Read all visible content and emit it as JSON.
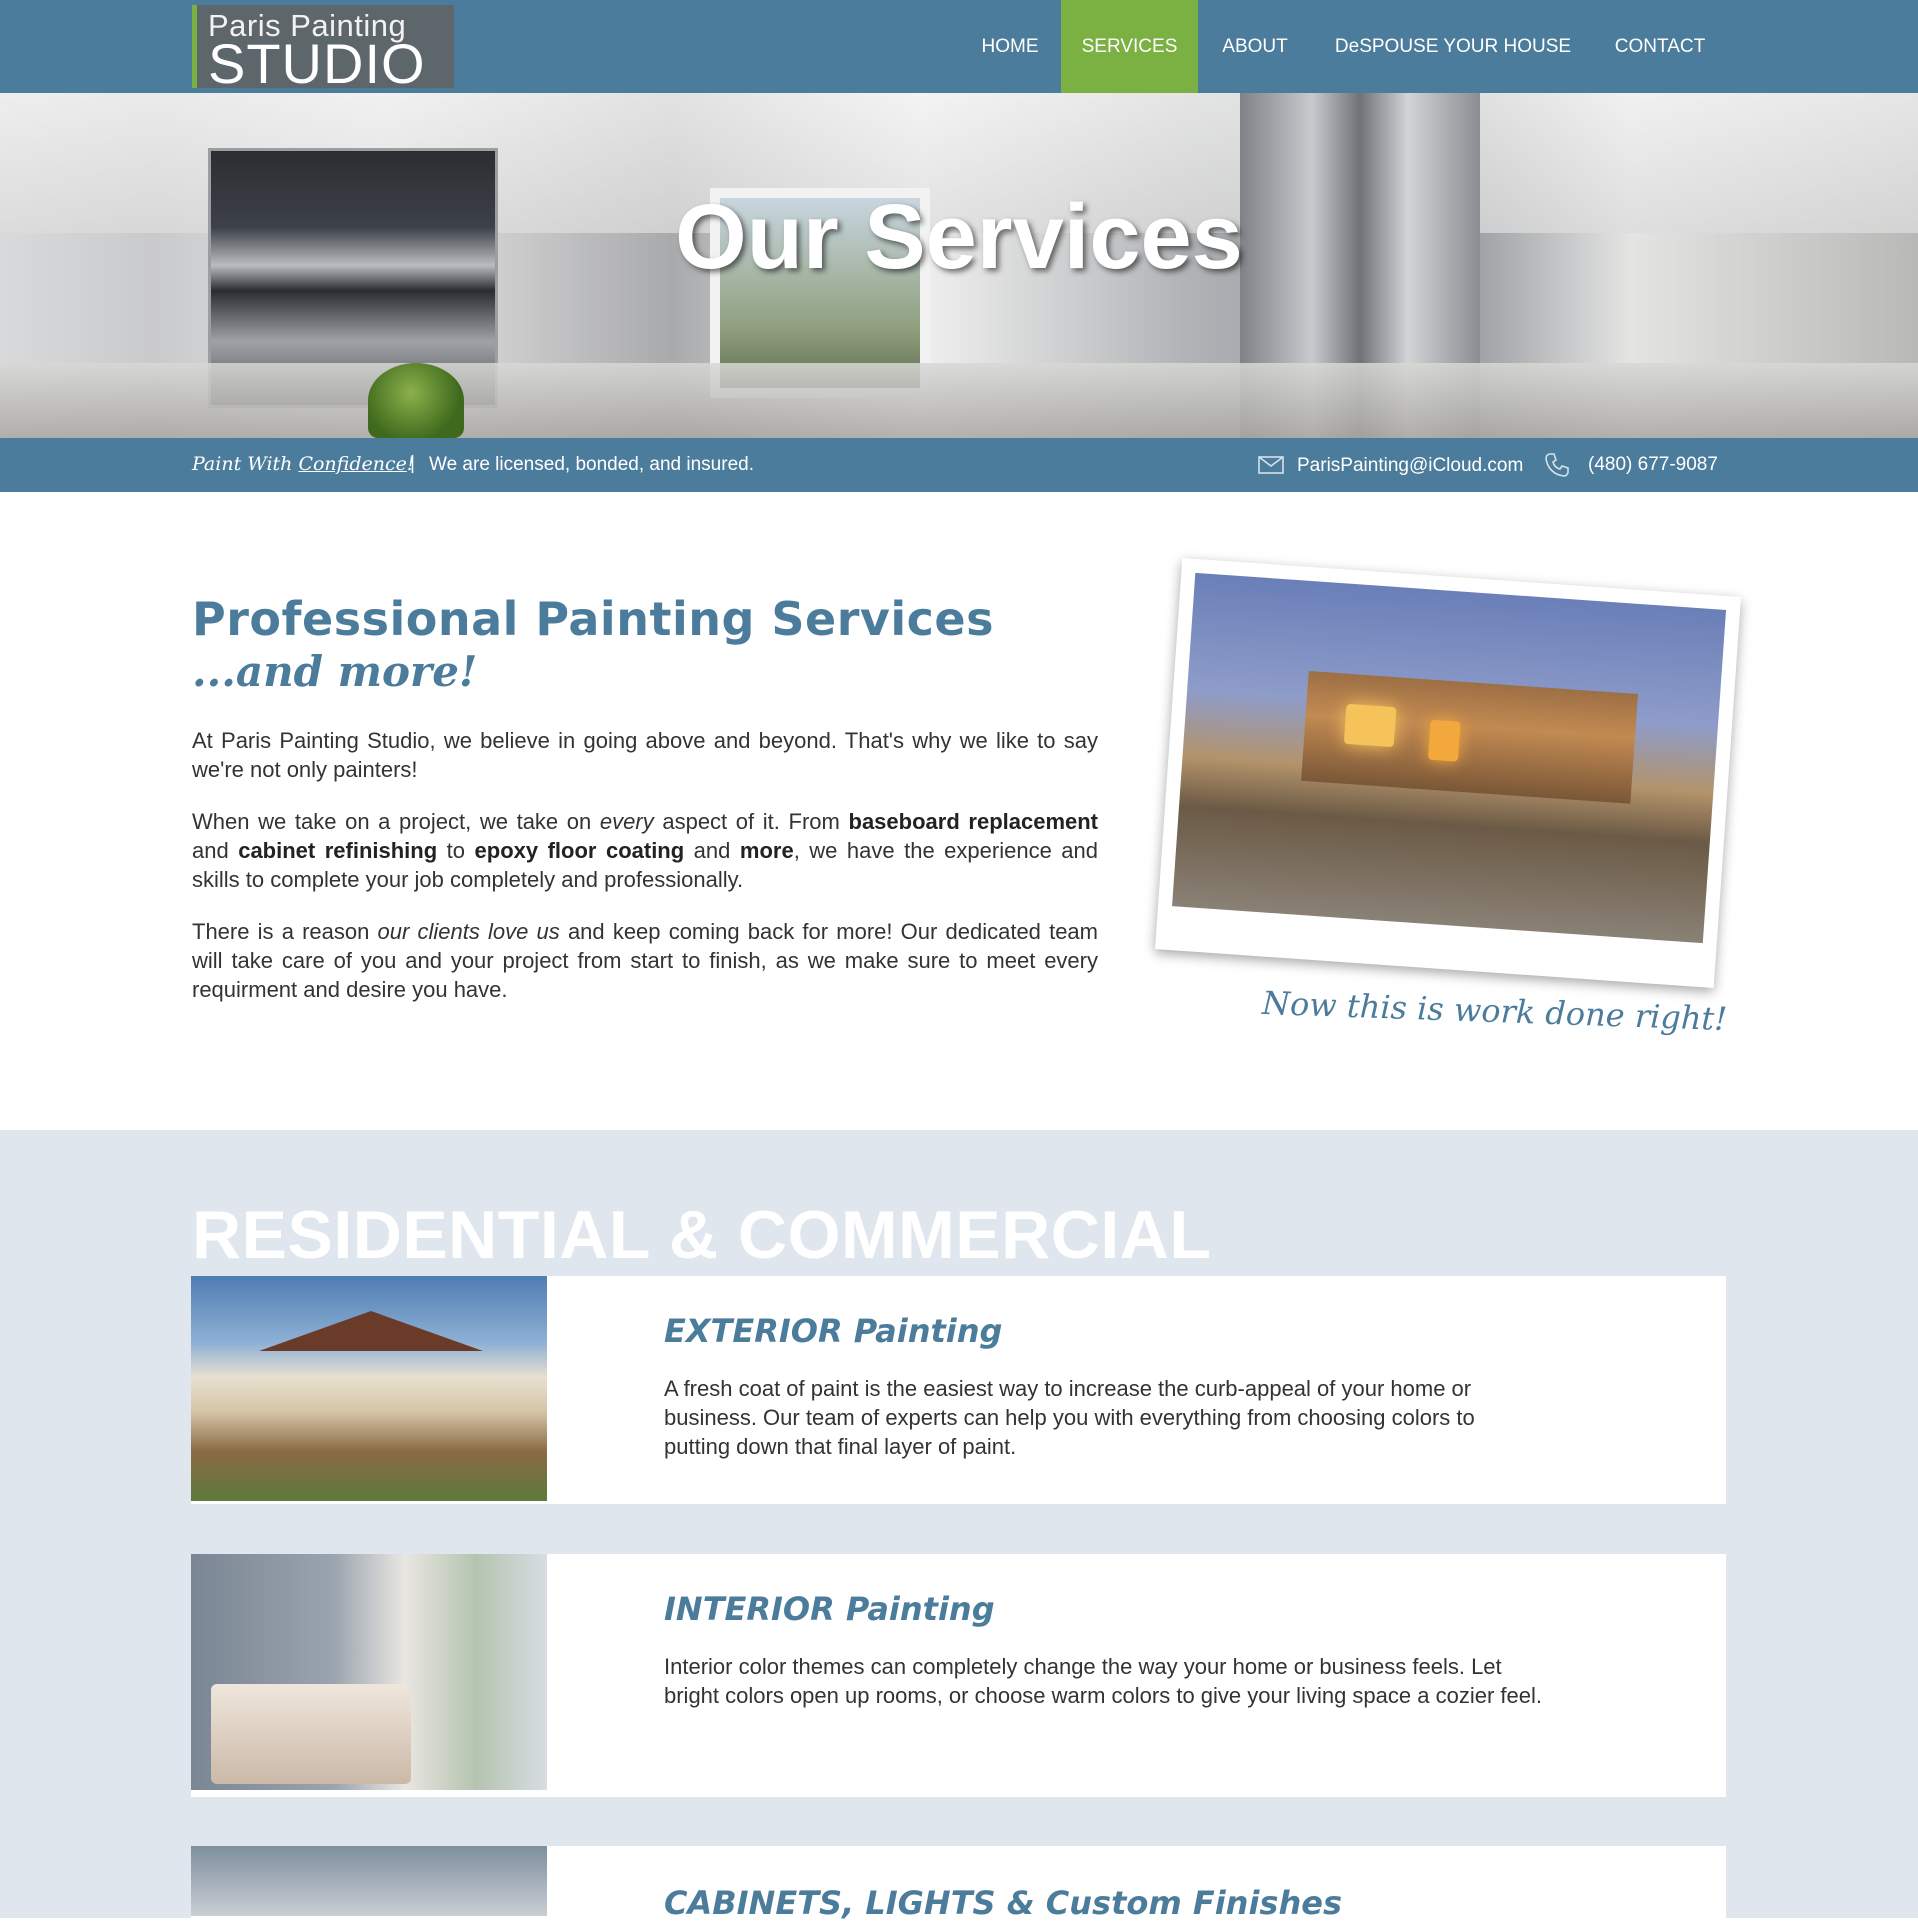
{
  "header": {
    "logo_line1": "Paris Painting",
    "logo_line2": "STUDIO",
    "nav": [
      "HOME",
      "SERVICES",
      "ABOUT",
      "DeSPOUSE YOUR HOUSE",
      "CONTACT"
    ],
    "active_nav": "SERVICES"
  },
  "hero": {
    "title": "Our Services"
  },
  "infobar": {
    "tagline_prefix": "Paint With ",
    "tagline_emphasis": "Confidence",
    "tagline_suffix": "!",
    "separator": "|",
    "licensed": "We are licensed, bonded, and insured.",
    "email": "ParisPainting@iCloud.com",
    "phone": "(480) 677-9087",
    "icons": [
      "envelope-icon",
      "phone-icon"
    ]
  },
  "intro": {
    "heading": "Professional Painting Services",
    "subheading": "...and more!",
    "p1": "At Paris Painting Studio, we believe in going above and beyond. That's why we like to say we're not only painters!",
    "p2": {
      "t1": "When we take on a project, we take on ",
      "em1": "every",
      "t2": " aspect of it. From ",
      "b1": "baseboard replacement",
      "t3": " and ",
      "b2": "cabinet refinishing",
      "t4": " to ",
      "b3": "epoxy floor coating",
      "t5": " and ",
      "b4": "more",
      "t6": ", we have the experience and skills to complete your job completely and professionally."
    },
    "p3": {
      "t1": "There is a reason ",
      "em1": "our clients love us",
      "t2": " and keep coming back for more! Our dedicated team will take care of you and your project from start to finish, as we make sure to meet every requirment and desire you have."
    },
    "photo_caption": "Now this is work done right!"
  },
  "services": {
    "section_title": "RESIDENTIAL & COMMERCIAL",
    "items": [
      {
        "title": "EXTERIOR Painting",
        "text": "A fresh coat of paint is the easiest way to increase the curb-appeal of your home or business. Our team of experts can help you with everything from choosing colors to putting down that final layer of paint."
      },
      {
        "title": "INTERIOR Painting",
        "text": "Interior color themes can completely change the way your home or business feels. Let bright colors open up rooms, or choose warm colors to give your living space a cozier feel."
      },
      {
        "title": "CABINETS, LIGHTS & Custom Finishes",
        "text": ""
      }
    ]
  },
  "colors": {
    "brand_blue": "#4c7c9b",
    "accent_green": "#7bb042",
    "band_bg": "#dfe6ee"
  }
}
